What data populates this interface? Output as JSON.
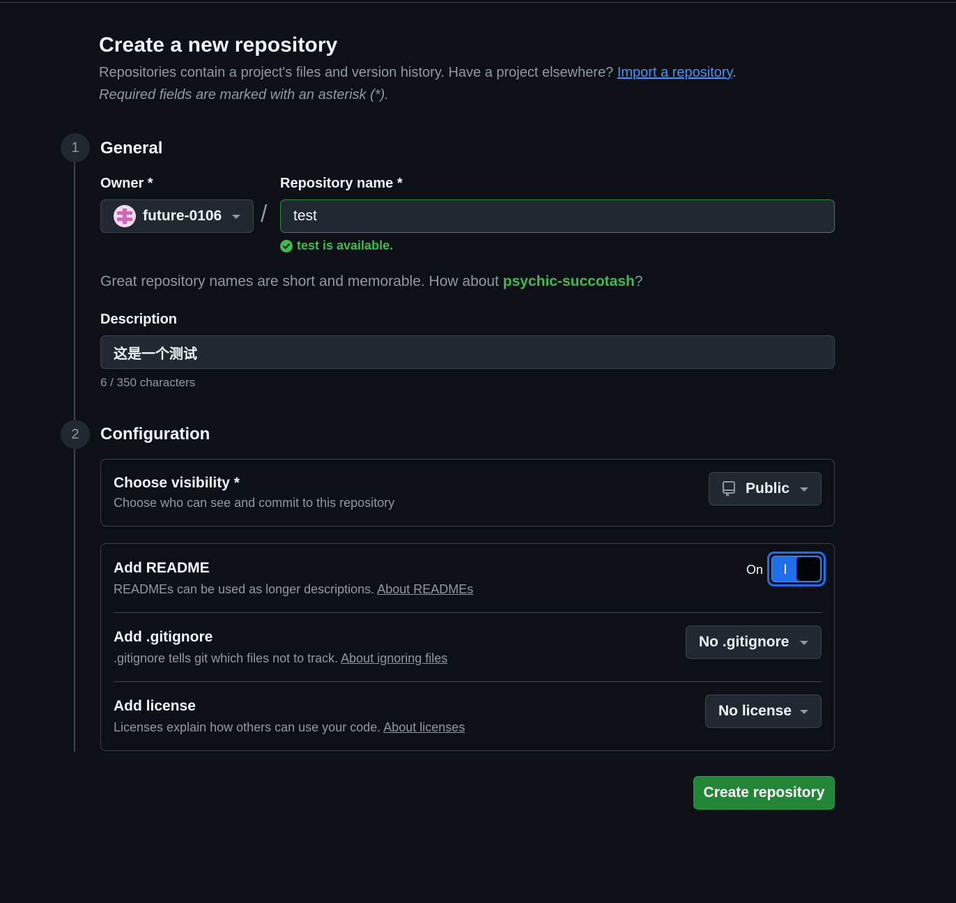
{
  "header": {
    "title": "Create a new repository",
    "intro_text": "Repositories contain a project's files and version history. Have a project elsewhere? ",
    "import_link": "Import a repository",
    "intro_end": ".",
    "required_note": "Required fields are marked with an asterisk (*)."
  },
  "general": {
    "step_number": "1",
    "title": "General",
    "owner_label": "Owner *",
    "owner_value": "future-0106",
    "slash": "/",
    "repo_name_label": "Repository name *",
    "repo_name_value": "test",
    "availability": "test is available.",
    "suggestion_prefix": "Great repository names are short and memorable. How about ",
    "suggestion_name": "psychic-succotash",
    "suggestion_suffix": "?",
    "description_label": "Description",
    "description_value": "这是一个测试",
    "char_count": "6 / 350 characters"
  },
  "configuration": {
    "step_number": "2",
    "title": "Configuration",
    "visibility": {
      "title": "Choose visibility *",
      "description": "Choose who can see and commit to this repository",
      "value": "Public",
      "icon": "repo-icon"
    },
    "readme": {
      "title": "Add README",
      "description": "READMEs can be used as longer descriptions. ",
      "link": "About READMEs",
      "toggle_label": "On",
      "toggle_on": true,
      "accent_color": "#1f6feb"
    },
    "gitignore": {
      "title": "Add .gitignore",
      "description": ".gitignore tells git which files not to track. ",
      "link": "About ignoring files",
      "value": "No .gitignore"
    },
    "license": {
      "title": "Add license",
      "description": "Licenses explain how others can use your code. ",
      "link": "About licenses",
      "value": "No license"
    }
  },
  "actions": {
    "create_label": "Create repository",
    "create_color": "#238636"
  }
}
